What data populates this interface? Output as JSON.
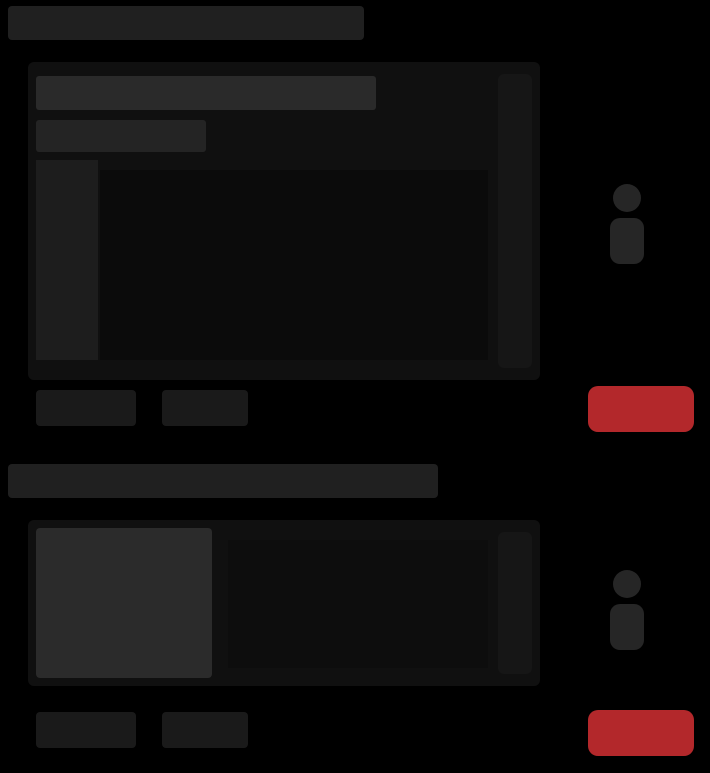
{
  "theme": {
    "background": "#000000",
    "card": "#101010",
    "danger": "#b3282b"
  },
  "sections": [
    {
      "heading": "",
      "title": "",
      "subtitle": "",
      "buttons": [
        "",
        ""
      ],
      "action_icon": "user-icon",
      "danger_label": ""
    },
    {
      "heading": "",
      "title": "",
      "subtitle": "",
      "buttons": [
        "",
        ""
      ],
      "action_icon": "user-icon",
      "danger_label": ""
    }
  ]
}
